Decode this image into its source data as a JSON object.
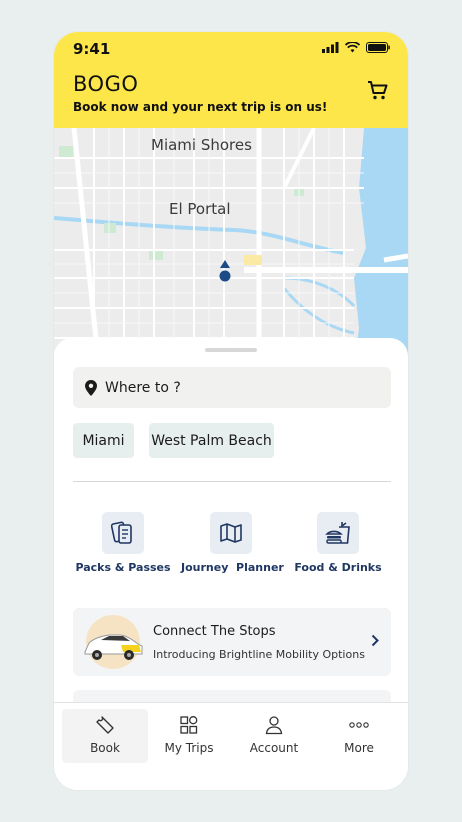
{
  "status_bar": {
    "time": "9:41"
  },
  "header": {
    "title": "BOGO",
    "subtitle": "Book now and your next trip is on us!",
    "cart_icon": "cart-icon"
  },
  "map": {
    "labels": [
      "Miami Shores",
      "El Portal"
    ],
    "colors": {
      "water": "#a9d8f5",
      "land": "#ececec",
      "park": "#cfead3",
      "road": "#ffffff",
      "pin": "#1b4a86"
    }
  },
  "search": {
    "placeholder": "Where to ?",
    "icon": "location-pin-icon"
  },
  "chips": [
    "Miami",
    "West Palm Beach"
  ],
  "actions": [
    {
      "label": "Packs & Passes",
      "icon": "passes-icon"
    },
    {
      "label": "Journey  Planner",
      "icon": "map-icon"
    },
    {
      "label": "Food & Drinks",
      "icon": "food-drink-icon"
    }
  ],
  "promo_card": {
    "title": "Connect The Stops",
    "subtitle": "Introducing Brightline Mobility Options"
  },
  "nav": {
    "items": [
      {
        "label": "Book",
        "icon": "ticket-icon",
        "active": true
      },
      {
        "label": "My Trips",
        "icon": "grid-icon",
        "active": false
      },
      {
        "label": "Account",
        "icon": "person-icon",
        "active": false
      },
      {
        "label": "More",
        "icon": "more-icon",
        "active": false
      }
    ]
  },
  "colors": {
    "brand_yellow": "#fde64a",
    "accent_navy": "#1f3762",
    "chip_bg": "#e6efed"
  }
}
